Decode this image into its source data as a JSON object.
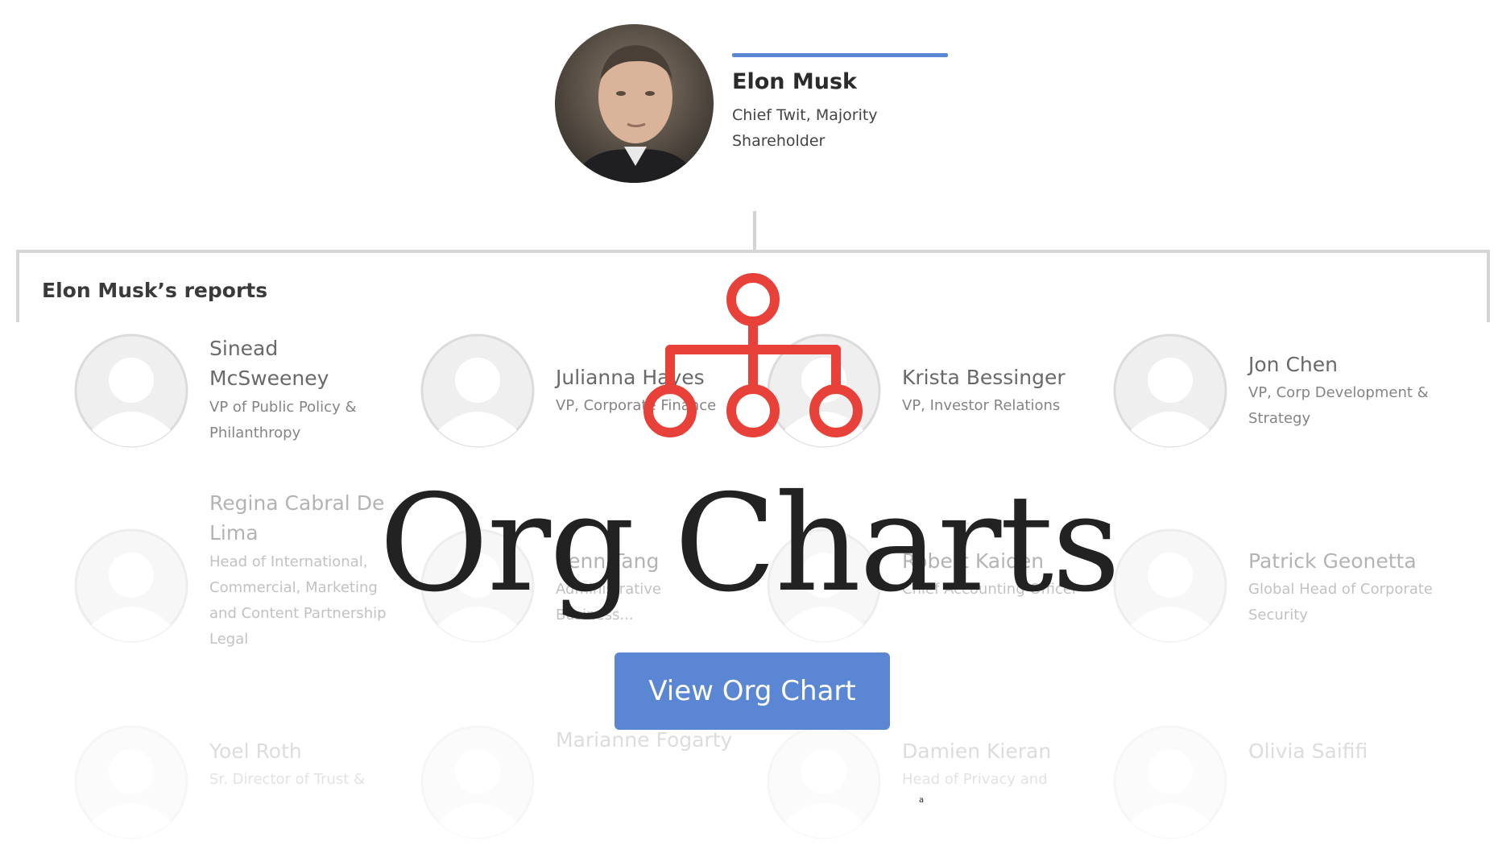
{
  "top": {
    "name": "Elon Musk",
    "title": "Chief Twit, Majority Shareholder"
  },
  "reports_title": "Elon Musk’s reports",
  "reports": [
    {
      "name": "Sinead McSweeney",
      "title": "VP of Public Policy & Philanthropy"
    },
    {
      "name": "Julianna Hayes",
      "title": "VP, Corporate Finance"
    },
    {
      "name": "Krista Bessinger",
      "title": "VP, Investor Relations"
    },
    {
      "name": "Jon Chen",
      "title": "VP, Corp Development & Strategy"
    },
    {
      "name": "Regina Cabral De Lima",
      "title": "Head of International, Commercial, Marketing and Content Partnership Legal"
    },
    {
      "name": "Kenn Tang",
      "title": "Administrative Business..."
    },
    {
      "name": "Robert Kaiden",
      "title": "Chief Accounting Officer"
    },
    {
      "name": "Patrick Geonetta",
      "title": "Global Head of Corporate Security"
    },
    {
      "name": "Yoel Roth",
      "title": "Sr. Director of Trust &"
    },
    {
      "name": "Marianne Fogarty",
      "title": ""
    },
    {
      "name": "Damien Kieran",
      "title": "Head of Privacy and"
    },
    {
      "name": "Olivia Saififi",
      "title": ""
    }
  ],
  "overlay": {
    "heading": "Org Charts",
    "button_label": "View Org Chart",
    "footnote_mark": "a"
  },
  "colors": {
    "accent": "#5b86d4",
    "icon_red": "#e8413a",
    "heading": "#222222"
  },
  "icons": [
    "org-hierarchy-icon",
    "avatar-placeholder-icon"
  ]
}
